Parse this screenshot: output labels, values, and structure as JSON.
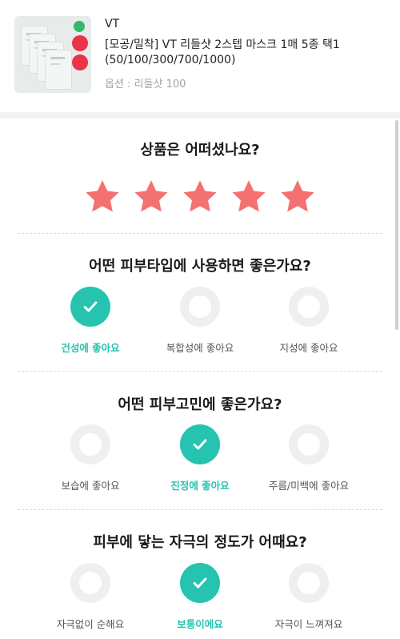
{
  "product": {
    "brand": "VT",
    "name": "[모공/밀착] VT 리들샷 2스텝 마스크 1매 5종 택1 (50/100/300/700/1000)",
    "option": "옵션 : 리들샷 100"
  },
  "rating": {
    "title": "상품은 어떠셨나요?",
    "value": 5,
    "max": 5,
    "color": "#f47171"
  },
  "questions": [
    {
      "title": "어떤 피부타입에 사용하면 좋은가요?",
      "options": [
        {
          "label": "건성에 좋아요",
          "selected": true
        },
        {
          "label": "복합성에 좋아요",
          "selected": false
        },
        {
          "label": "지성에 좋아요",
          "selected": false
        }
      ]
    },
    {
      "title": "어떤 피부고민에 좋은가요?",
      "options": [
        {
          "label": "보습에 좋아요",
          "selected": false
        },
        {
          "label": "진정에 좋아요",
          "selected": true
        },
        {
          "label": "주름/미백에 좋아요",
          "selected": false
        }
      ]
    },
    {
      "title": "피부에 닿는 자극의 정도가 어때요?",
      "options": [
        {
          "label": "자극없이 순해요",
          "selected": false
        },
        {
          "label": "보통이에요",
          "selected": true
        },
        {
          "label": "자극이 느껴져요",
          "selected": false
        }
      ]
    }
  ],
  "colors": {
    "accent": "#25c3b0",
    "unselected_ring": "#efefef"
  }
}
